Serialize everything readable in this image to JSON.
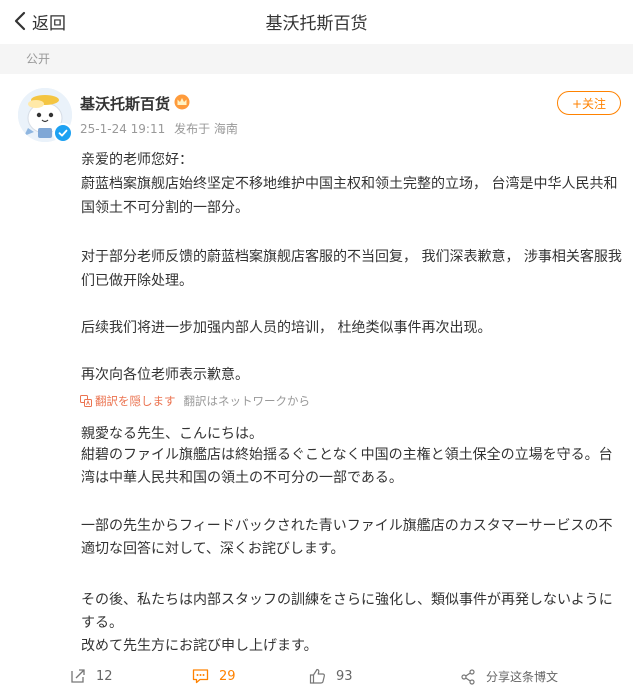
{
  "nav": {
    "back_label": "返回",
    "title": "基沃托斯百货"
  },
  "visibility": "公开",
  "post": {
    "author": "基沃托斯百货",
    "time": "25-1-24 19:11",
    "source": "发布于 海南",
    "follow_label": "+关注",
    "paragraphs": [
      "亲爱的老师您好：",
      "蔚蓝档案旗舰店始终坚定不移地维护中国主权和领土完整的立场， 台湾是中华人民共和国领土不可分割的一部分。",
      "对于部分老师反馈的蔚蓝档案旗舰店客服的不当回复， 我们深表歉意， 涉事相关客服我们已做开除处理。",
      "后续我们将进一步加强内部人员的培训， 杜绝类似事件再次出现。",
      "再次向各位老师表示歉意。"
    ],
    "translation": {
      "toggle_label": "翻訳を隠します",
      "source_label": "翻訳はネットワークから",
      "paragraphs": [
        "親愛なる先生、こんにちは。",
        "紺碧のファイル旗艦店は終始揺るぐことなく中国の主権と領土保全の立場を守る。台湾は中華人民共和国の領土の不可分の一部である。",
        "一部の先生からフィードバックされた青いファイル旗艦店のカスタマーサービスの不適切な回答に対して、深くお詫びします。",
        "その後、私たちは内部スタッフの訓練をさらに強化し、類似事件が再発しないようにする。",
        "改めて先生方にお詫び申し上げます。"
      ]
    },
    "actions": {
      "repost": "12",
      "comment": "29",
      "like": "93",
      "share": "分享这条博文"
    }
  },
  "colors": {
    "accent": "#ff8200",
    "translate": "#eb7350",
    "muted": "#999999",
    "verified": "#1da1f2"
  },
  "icons": [
    "chevron-left-icon",
    "crown-icon",
    "verified-badge-icon",
    "translate-icon",
    "repost-icon",
    "comment-icon",
    "like-icon",
    "share-icon"
  ]
}
